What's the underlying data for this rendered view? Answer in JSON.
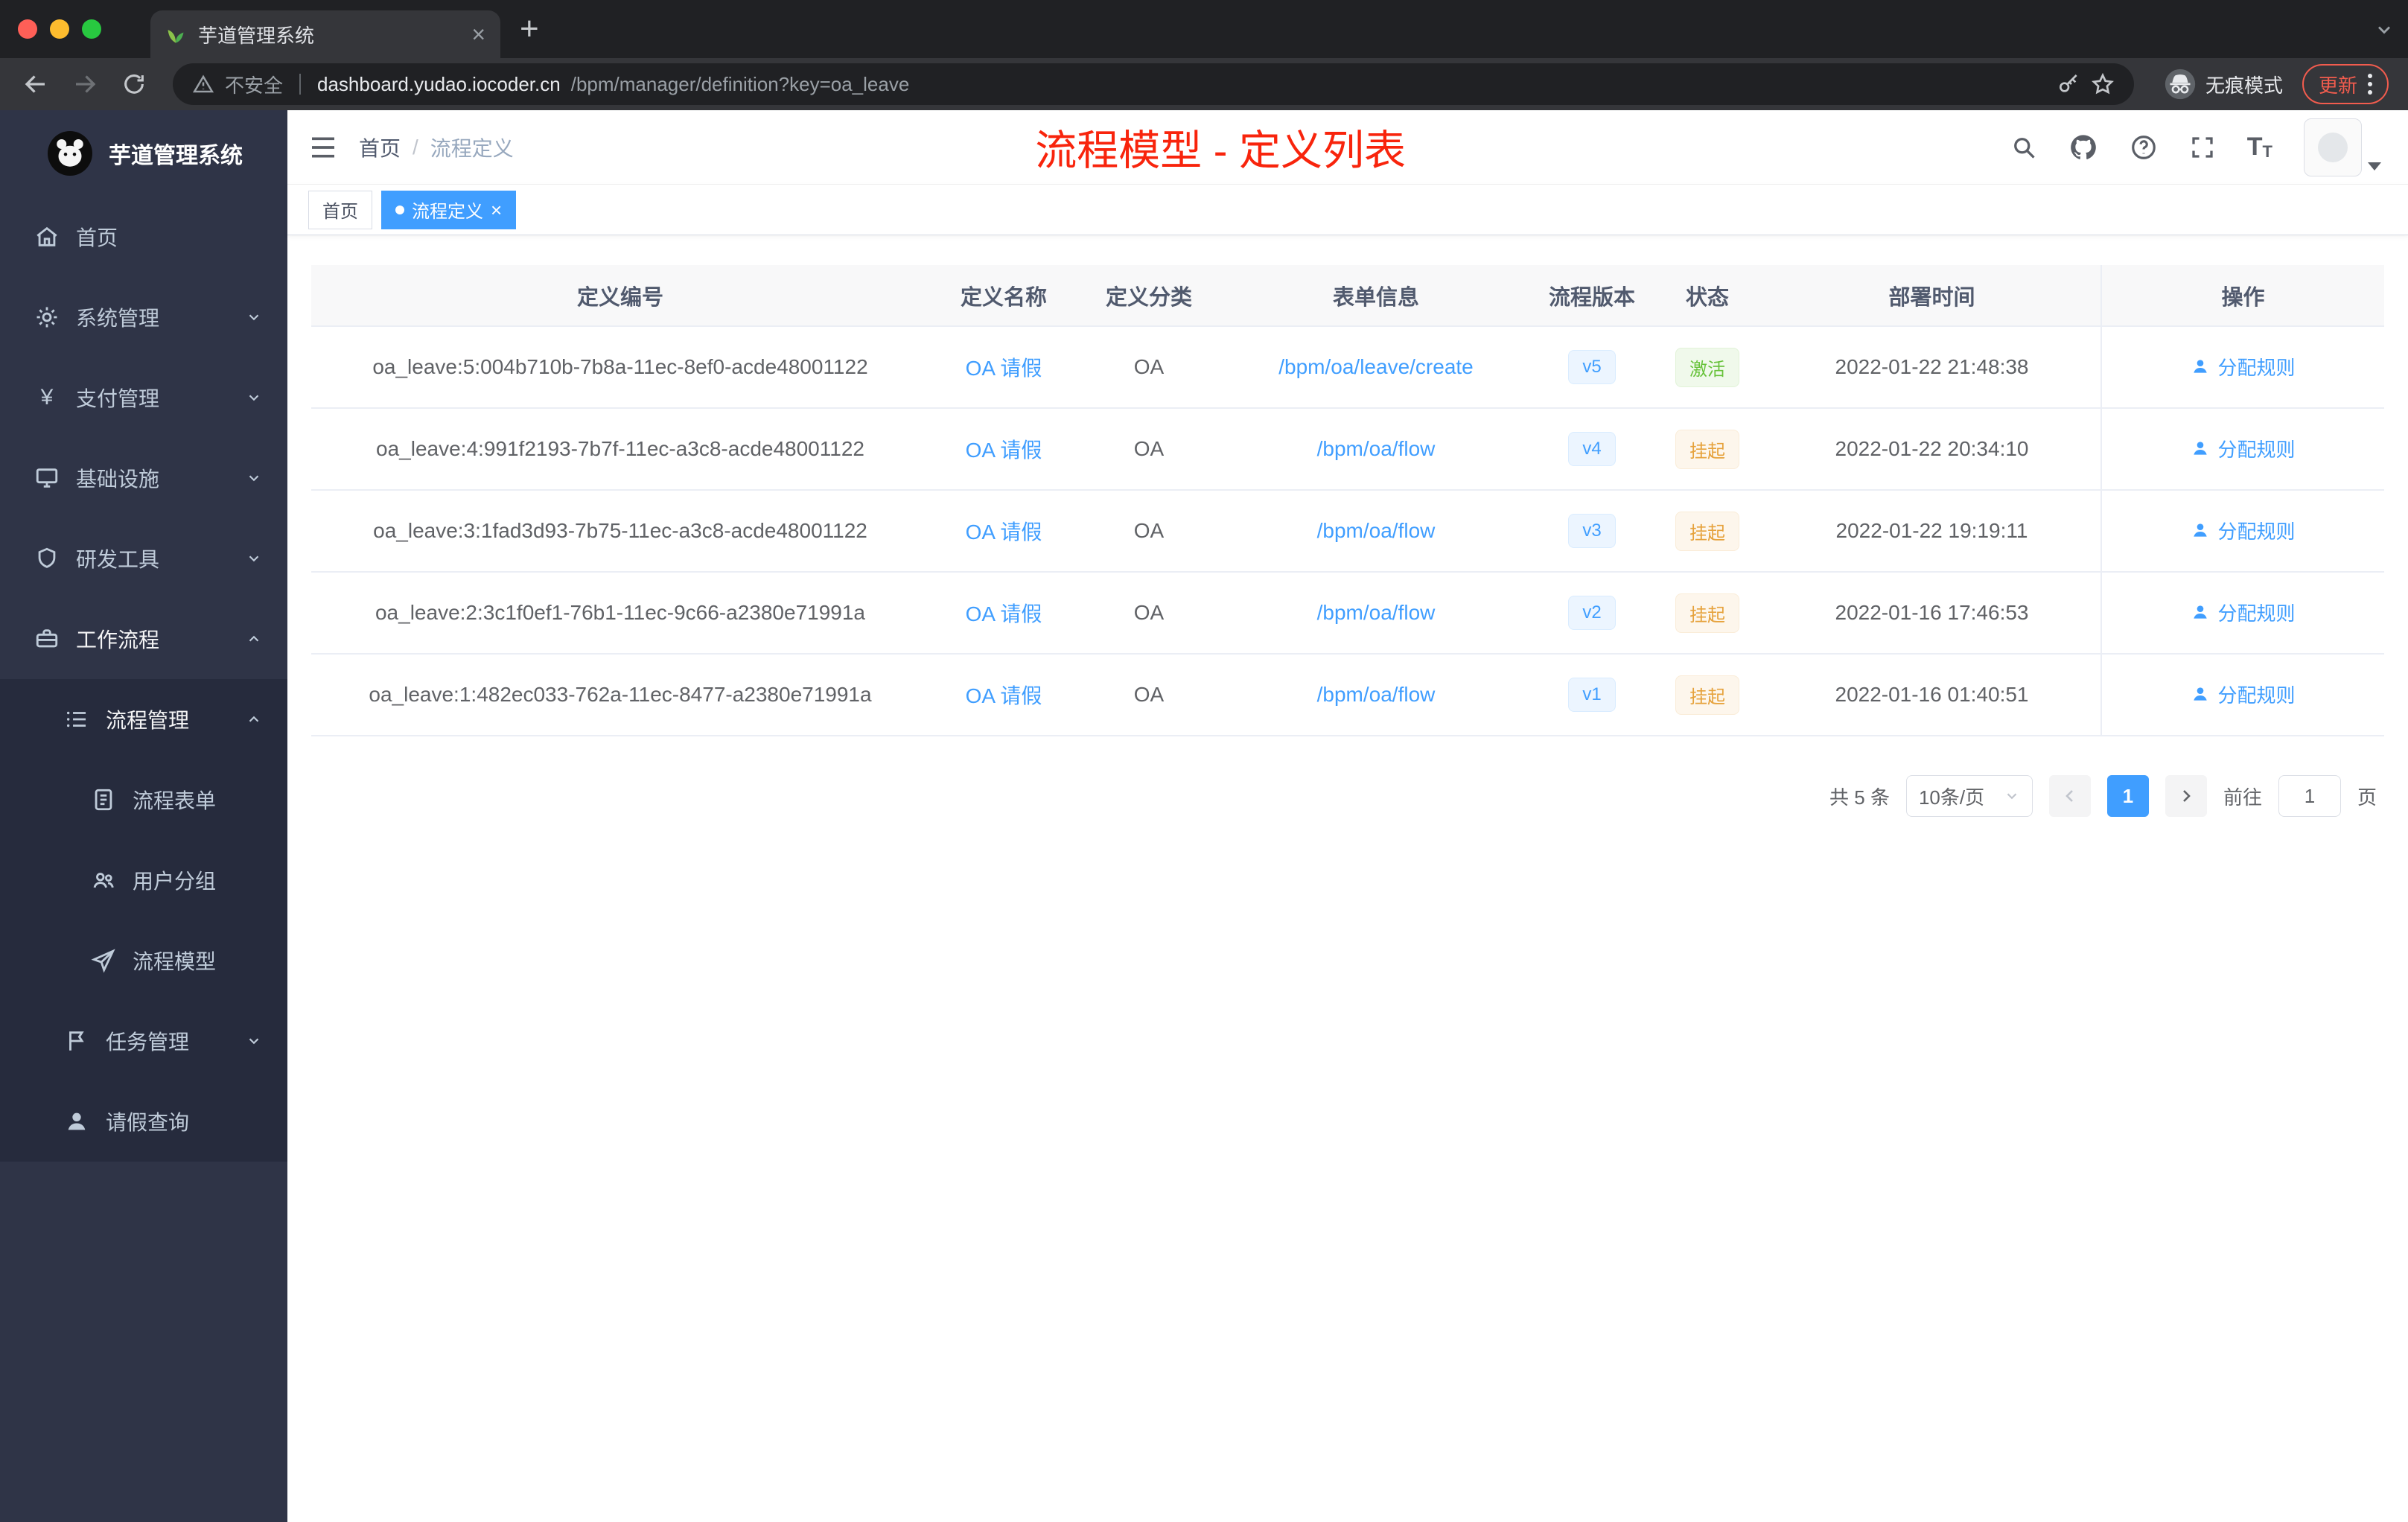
{
  "colors": {
    "accent": "#409eff",
    "annotation_red": "#f8240c",
    "success": "#67c23a",
    "warning": "#e6a23c"
  },
  "browser": {
    "tab_title": "芋道管理系统",
    "new_tab": "+",
    "security_label": "不安全",
    "url_host": "dashboard.yudao.iocoder.cn",
    "url_path": "/bpm/manager/definition?key=oa_leave",
    "incognito_label": "无痕模式",
    "update_label": "更新"
  },
  "sidebar": {
    "logo_title": "芋道管理系统",
    "items": [
      {
        "label": "首页",
        "icon": "home-icon",
        "level": 1
      },
      {
        "label": "系统管理",
        "icon": "gear-icon",
        "level": 1,
        "expandable": true,
        "expanded": false
      },
      {
        "label": "支付管理",
        "icon": "yen-icon",
        "level": 1,
        "expandable": true,
        "expanded": false
      },
      {
        "label": "基础设施",
        "icon": "monitor-icon",
        "level": 1,
        "expandable": true,
        "expanded": false
      },
      {
        "label": "研发工具",
        "icon": "shield-icon",
        "level": 1,
        "expandable": true,
        "expanded": false
      },
      {
        "label": "工作流程",
        "icon": "briefcase-icon",
        "level": 1,
        "expandable": true,
        "expanded": true
      },
      {
        "label": "流程管理",
        "icon": "list-icon",
        "level": 2,
        "expandable": true,
        "expanded": true
      },
      {
        "label": "流程表单",
        "icon": "form-icon",
        "level": 3
      },
      {
        "label": "用户分组",
        "icon": "users-icon",
        "level": 3
      },
      {
        "label": "流程模型",
        "icon": "paper-plane-icon",
        "level": 3
      },
      {
        "label": "任务管理",
        "icon": "flag-icon",
        "level": 2,
        "expandable": true,
        "expanded": false
      },
      {
        "label": "请假查询",
        "icon": "user-icon",
        "level": 2
      }
    ]
  },
  "header": {
    "breadcrumb_home": "首页",
    "breadcrumb_sep": "/",
    "breadcrumb_current": "流程定义",
    "annotation": "流程模型 - 定义列表"
  },
  "tags": {
    "home": "首页",
    "active": "流程定义"
  },
  "table": {
    "columns": [
      "定义编号",
      "定义名称",
      "定义分类",
      "表单信息",
      "流程版本",
      "状态",
      "部署时间",
      "操作"
    ],
    "rows": [
      {
        "id": "oa_leave:5:004b710b-7b8a-11ec-8ef0-acde48001122",
        "name": "OA 请假",
        "category": "OA",
        "form": "/bpm/oa/leave/create",
        "version": "v5",
        "status": "激活",
        "status_type": "success",
        "time": "2022-01-22 21:48:38",
        "action": "分配规则"
      },
      {
        "id": "oa_leave:4:991f2193-7b7f-11ec-a3c8-acde48001122",
        "name": "OA 请假",
        "category": "OA",
        "form": "/bpm/oa/flow",
        "version": "v4",
        "status": "挂起",
        "status_type": "warning",
        "time": "2022-01-22 20:34:10",
        "action": "分配规则"
      },
      {
        "id": "oa_leave:3:1fad3d93-7b75-11ec-a3c8-acde48001122",
        "name": "OA 请假",
        "category": "OA",
        "form": "/bpm/oa/flow",
        "version": "v3",
        "status": "挂起",
        "status_type": "warning",
        "time": "2022-01-22 19:19:11",
        "action": "分配规则"
      },
      {
        "id": "oa_leave:2:3c1f0ef1-76b1-11ec-9c66-a2380e71991a",
        "name": "OA 请假",
        "category": "OA",
        "form": "/bpm/oa/flow",
        "version": "v2",
        "status": "挂起",
        "status_type": "warning",
        "time": "2022-01-16 17:46:53",
        "action": "分配规则"
      },
      {
        "id": "oa_leave:1:482ec033-762a-11ec-8477-a2380e71991a",
        "name": "OA 请假",
        "category": "OA",
        "form": "/bpm/oa/flow",
        "version": "v1",
        "status": "挂起",
        "status_type": "warning",
        "time": "2022-01-16 01:40:51",
        "action": "分配规则"
      }
    ]
  },
  "pagination": {
    "total": "共 5 条",
    "size": "10条/页",
    "page": "1",
    "goto_label": "前往",
    "goto_value": "1",
    "unit": "页"
  }
}
